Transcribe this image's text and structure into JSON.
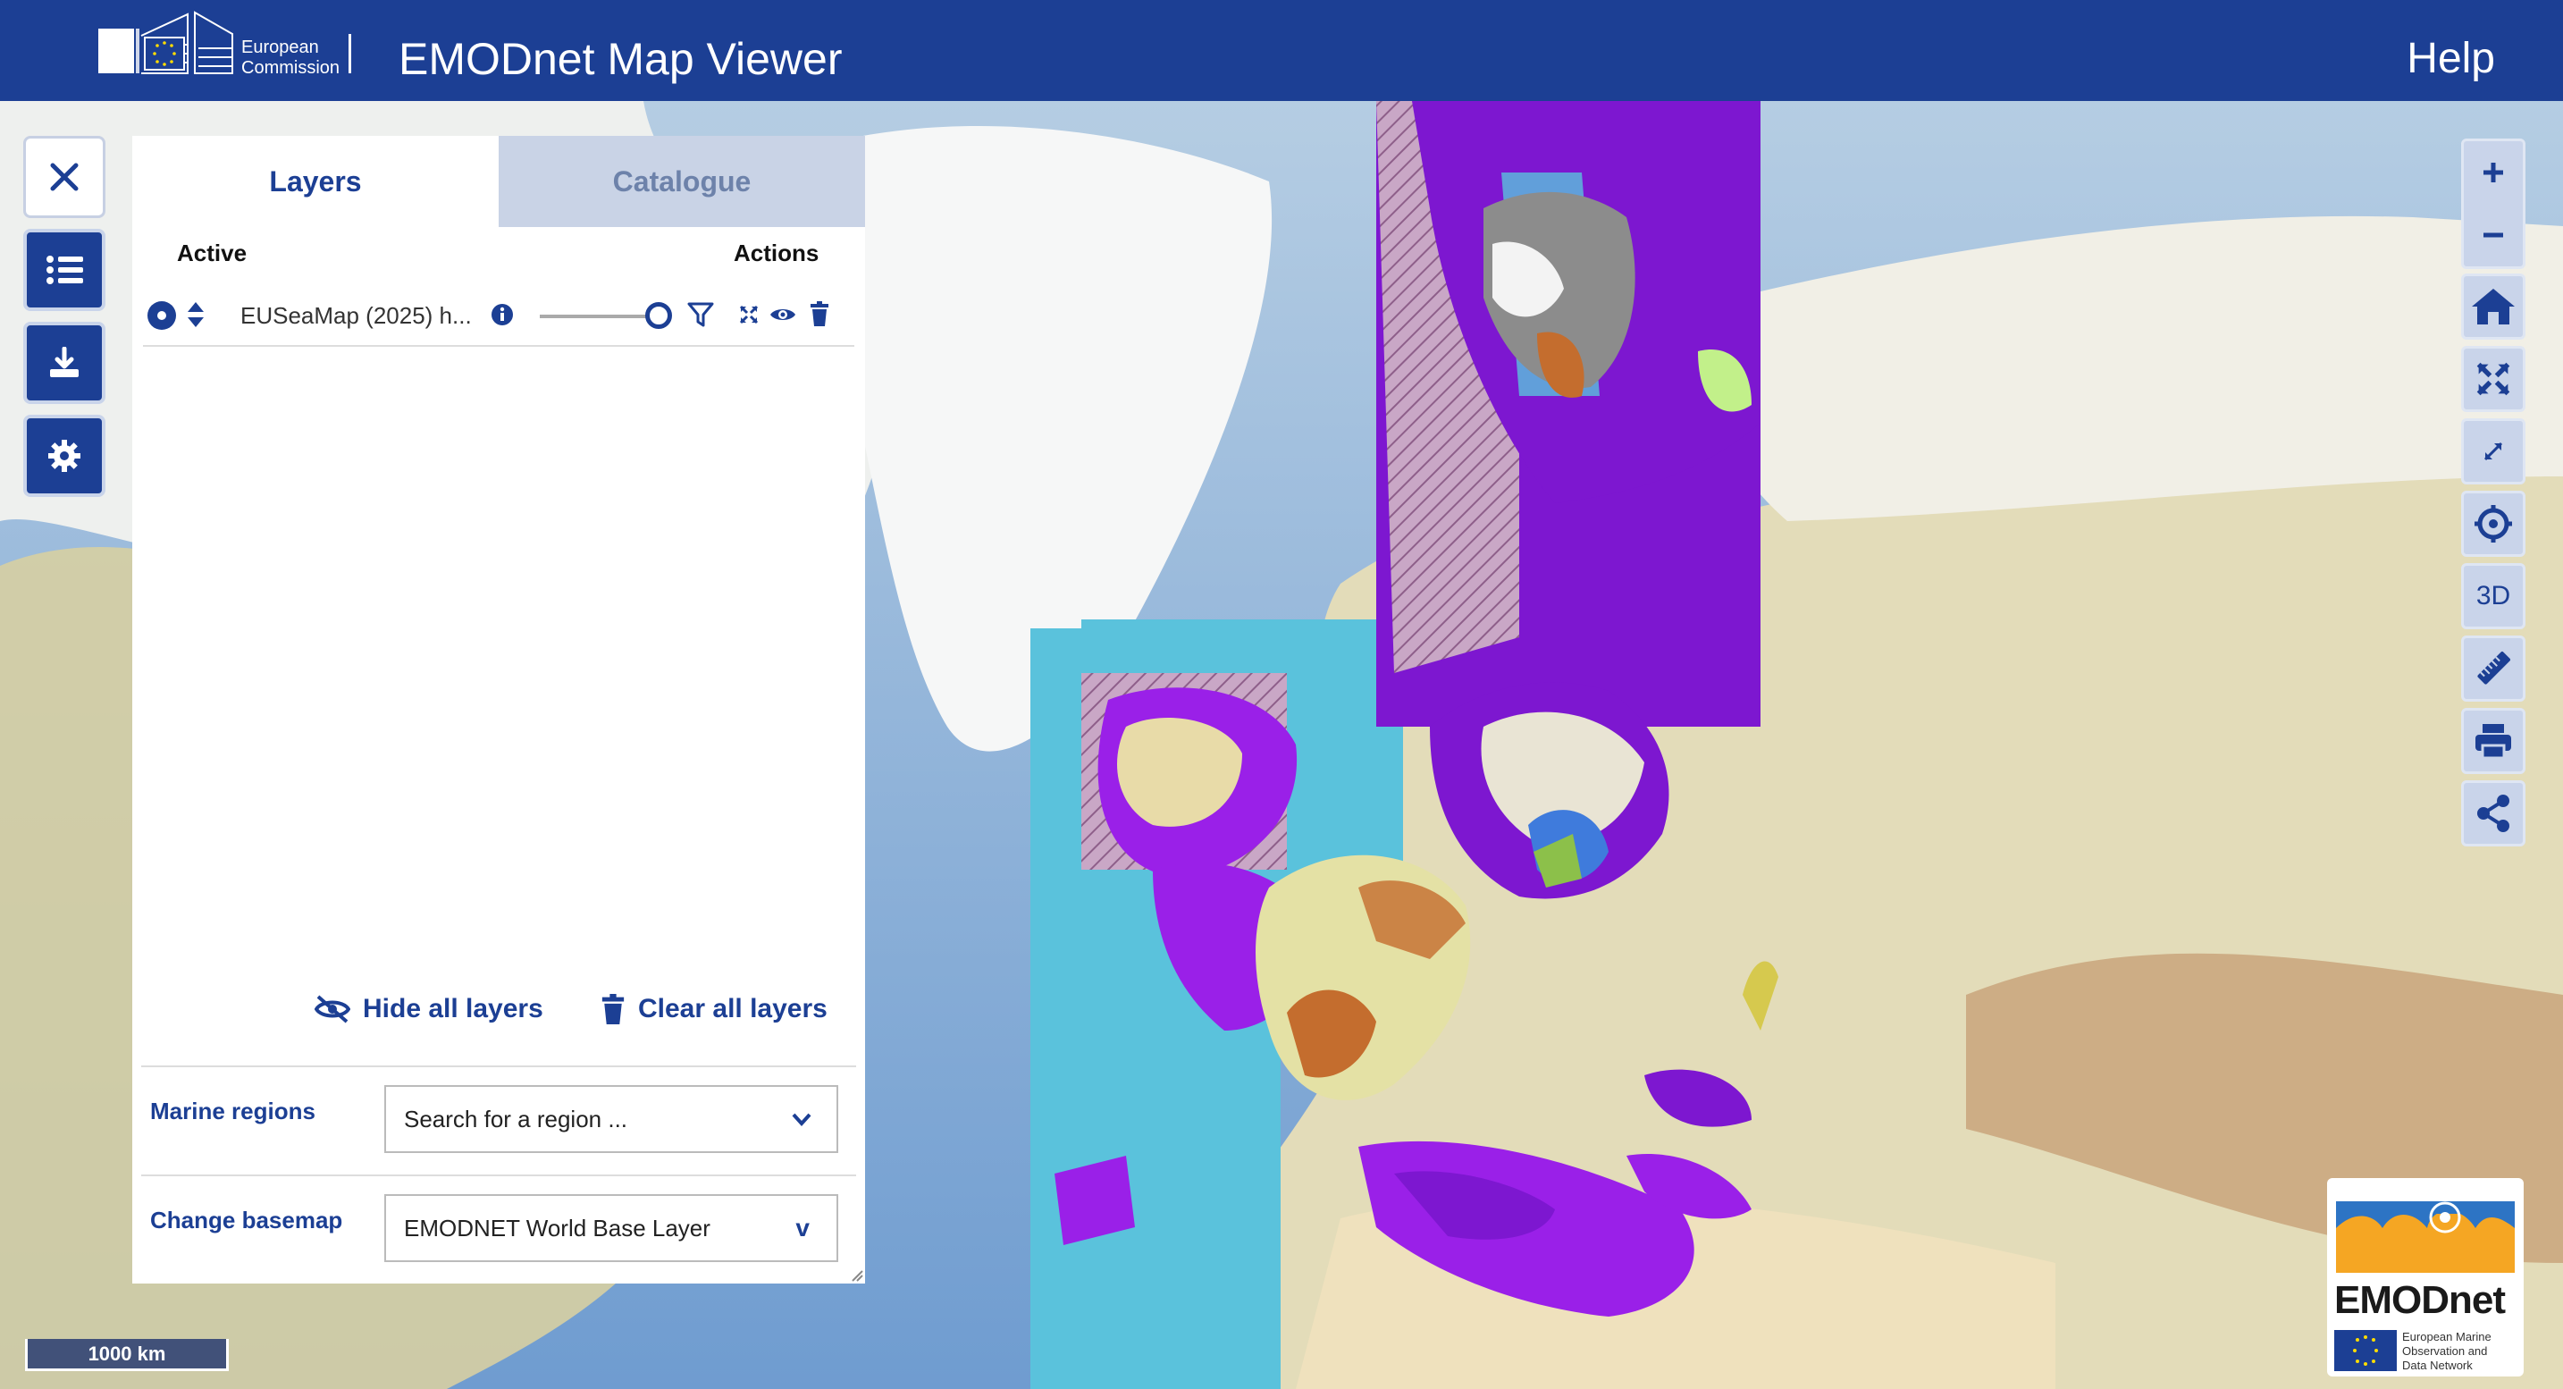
{
  "header": {
    "org_line1": "European",
    "org_line2": "Commission",
    "title": "EMODnet Map Viewer",
    "help_label": "Help"
  },
  "left_toolbar": {
    "close_icon": "close-icon",
    "layers_icon": "list-icon",
    "download_icon": "download-icon",
    "settings_icon": "gear-icon"
  },
  "panel": {
    "tabs": [
      {
        "label": "Layers",
        "active": true
      },
      {
        "label": "Catalogue",
        "active": false
      }
    ],
    "active_header": "Active",
    "actions_header": "Actions",
    "layers": [
      {
        "name": "EUSeaMap (2025) h...",
        "opacity": 1.0,
        "visible": true
      }
    ],
    "hide_all_label": "Hide all layers",
    "clear_all_label": "Clear all layers",
    "marine_regions_label": "Marine regions",
    "marine_regions_placeholder": "Search for a region ...",
    "basemap_label": "Change basemap",
    "basemap_value": "EMODNET World Base Layer",
    "basemap_chevron": "v"
  },
  "right_toolbar": {
    "three_d_label": "3D",
    "tools": [
      "zoom-in-icon",
      "zoom-out-icon",
      "home-icon",
      "full-extent-icon",
      "fullscreen-icon",
      "locate-icon",
      "3d",
      "measure-icon",
      "print-icon",
      "share-icon"
    ]
  },
  "scale_bar": "1000 km",
  "emodnet_logo": {
    "name": "EMODnet",
    "subtitle_1": "European Marine",
    "subtitle_2": "Observation and",
    "subtitle_3": "Data Network"
  },
  "colors": {
    "brand_blue": "#1c3f94",
    "layer_purple": "#7d17d0",
    "layer_cyan": "#5ac2dc"
  }
}
